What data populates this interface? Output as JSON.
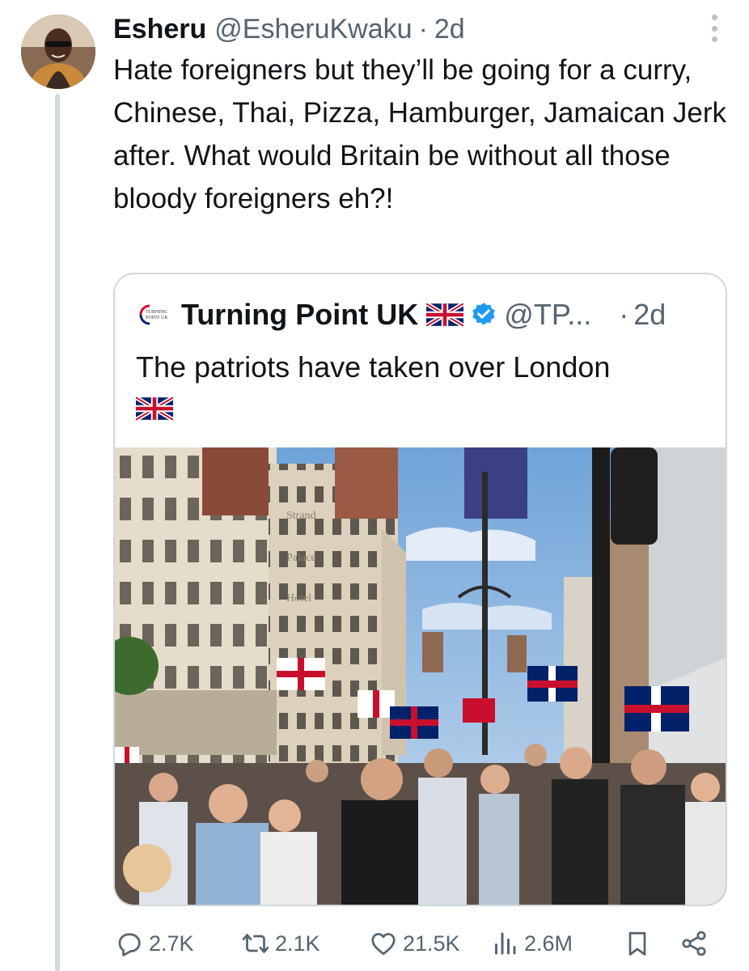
{
  "author": {
    "display_name": "Esheru",
    "handle": "@EsheruKwaku",
    "separator": "·",
    "time": "2d"
  },
  "tweet": {
    "text": "Hate foreigners but they’ll be going for a curry, Chinese, Thai, Pizza, Hamburger, Jamaican Jerk after. What would Britain be without all those bloody foreigners eh?!"
  },
  "quote": {
    "display_name": "Turning Point UK",
    "handle": "@TP...",
    "separator": "·",
    "time": "2d",
    "text": "The patriots have taken over London",
    "logo_text": "TURNING POINT UK",
    "flag_icon": "union-jack-flag-icon",
    "verified_icon": "verified-badge-icon",
    "photo_sign_text": [
      "Strand",
      "Palace",
      "Hotel"
    ]
  },
  "metrics": {
    "replies": "2.7K",
    "retweets": "2.1K",
    "likes": "21.5K",
    "views": "2.6M"
  },
  "icons": {
    "reply": "speech-bubble-icon",
    "retweet": "retweet-arrows-icon",
    "like": "heart-icon",
    "views": "bar-chart-icon",
    "bookmark": "bookmark-icon",
    "share": "share-nodes-icon",
    "more": "vertical-dots-icon"
  },
  "colors": {
    "text": "#0f1419",
    "secondary": "#536471",
    "border": "#cfd9de",
    "verified": "#1d9bf0",
    "flag_red": "#c8102e",
    "flag_blue": "#012169"
  }
}
